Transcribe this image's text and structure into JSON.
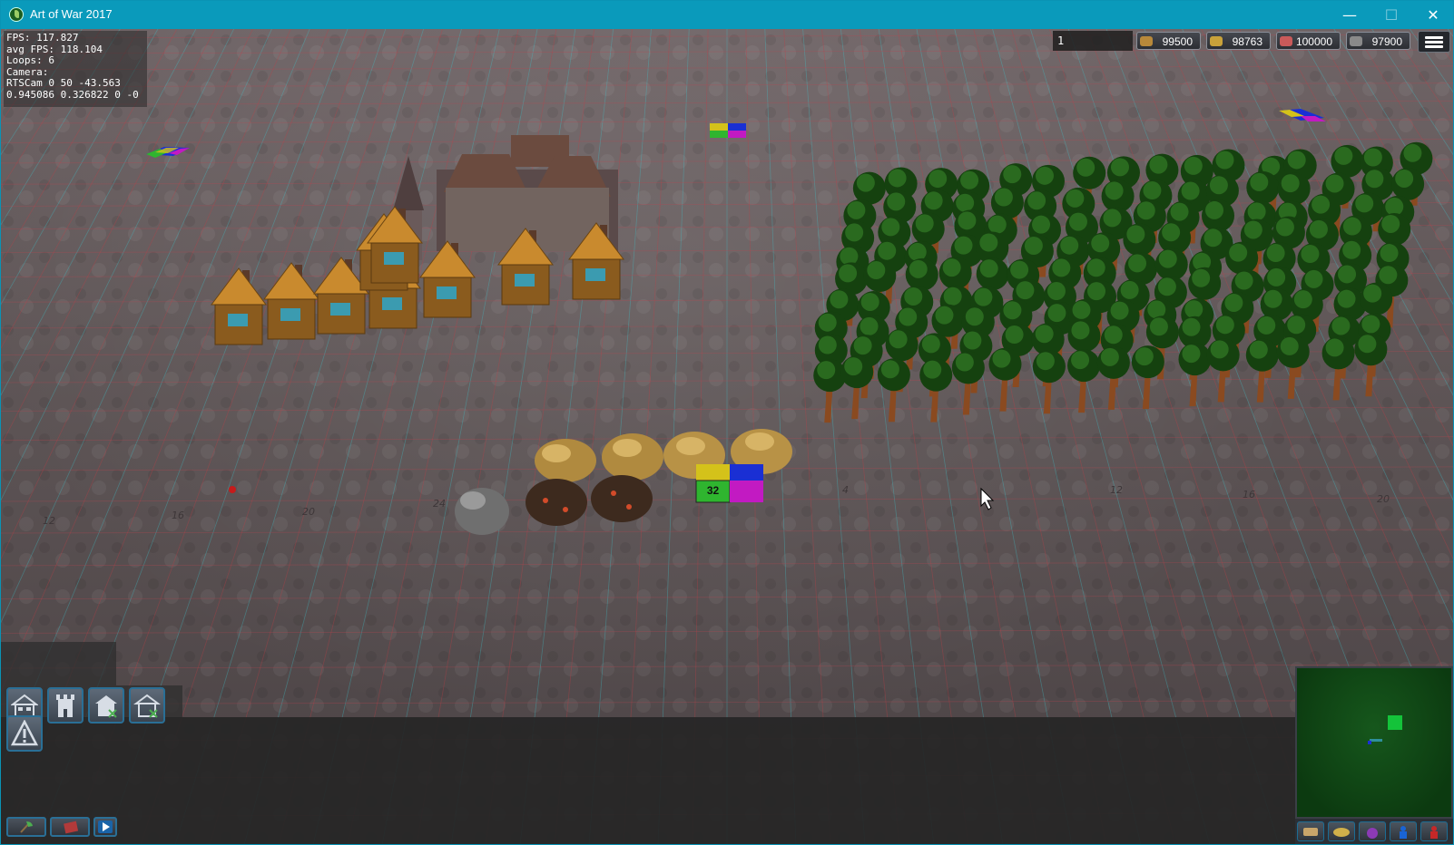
{
  "window": {
    "title": "Art of War 2017",
    "minimize_glyph": "—",
    "maximize_glyph": "☐",
    "close_glyph": "✕"
  },
  "debug": {
    "lines": [
      "FPS: 117.827",
      "avg FPS: 118.104",
      "Loops: 6",
      "Camera:",
      "RTSCam 0 50 -43.563",
      "0.945086 0.326822 0 -0"
    ]
  },
  "hud": {
    "turn": "1",
    "resources": [
      {
        "name": "wood",
        "value": "99500",
        "icon": "wood-icon",
        "color": "#b8893a"
      },
      {
        "name": "gold",
        "value": "98763",
        "icon": "gold-icon",
        "color": "#c9a23a"
      },
      {
        "name": "food",
        "value": "100000",
        "icon": "meat-icon",
        "color": "#c95a5a"
      },
      {
        "name": "stone",
        "value": "97900",
        "icon": "stone-icon",
        "color": "#8a8a8a"
      }
    ]
  },
  "map": {
    "tile_labels": [
      "12",
      "16",
      "20",
      "24",
      "4",
      "12",
      "16",
      "20"
    ],
    "selected_tile_label": "32",
    "player_colors": [
      "#2fb52f",
      "#d4c21a",
      "#1a2fd4",
      "#c21ac2"
    ]
  },
  "build_menu": {
    "items": [
      {
        "name": "house",
        "icon": "house-icon"
      },
      {
        "name": "tower",
        "icon": "tower-icon"
      },
      {
        "name": "farm",
        "icon": "farm-icon"
      },
      {
        "name": "barracks",
        "icon": "barracks-icon"
      },
      {
        "name": "warning",
        "icon": "warning-icon"
      }
    ]
  },
  "bottom_bar": {
    "buttons": [
      {
        "name": "gather",
        "icon": "axe-icon"
      },
      {
        "name": "book",
        "icon": "book-icon"
      },
      {
        "name": "play",
        "icon": "play-icon"
      }
    ]
  },
  "minimap": {
    "buttons": [
      "scroll-icon",
      "gold-icon",
      "potion-icon",
      "blue-unit-icon",
      "red-unit-icon"
    ]
  }
}
